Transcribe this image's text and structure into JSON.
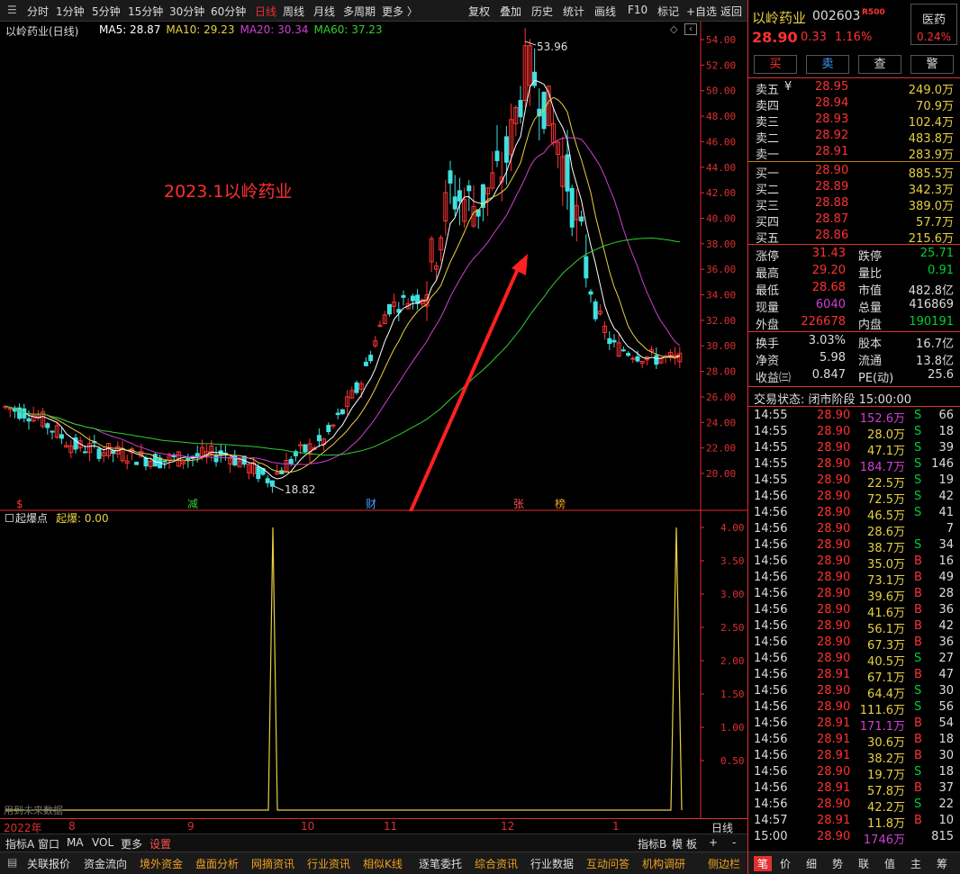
{
  "toolbar": {
    "left": [
      "分时",
      "1分钟",
      "5分钟",
      "15分钟",
      "30分钟",
      "60分钟",
      "日线",
      "周线",
      "月线",
      "多周期",
      "更多 〉"
    ],
    "active_index": 6,
    "right": [
      "复权",
      "叠加",
      "历史",
      "统计",
      "画线",
      "F10",
      "标记",
      "+自选",
      "返回"
    ]
  },
  "chart": {
    "title": "以岭药业(日线)",
    "ma": [
      {
        "label": "MA5: 28.87",
        "color": "#ffffff"
      },
      {
        "label": "MA10: 29.23",
        "color": "#e8d040"
      },
      {
        "label": "MA20: 30.34",
        "color": "#d040d0"
      },
      {
        "label": "MA60: 37.23",
        "color": "#30d030"
      }
    ],
    "annotation": "2023.1以岭药业",
    "high_label": "53.96",
    "low_label": "18.82",
    "price_ticks": [
      "54.00",
      "52.00",
      "50.00",
      "48.00",
      "46.00",
      "44.00",
      "42.00",
      "40.00",
      "38.00",
      "36.00",
      "34.00",
      "32.00",
      "30.00",
      "28.00",
      "26.00",
      "24.00",
      "22.00",
      "20.00"
    ],
    "events": [
      "$",
      "减",
      "财",
      "张",
      "榜"
    ],
    "indicator_title": "起爆点",
    "indicator_value": "起爆: 0.00",
    "ind_ticks": [
      "4.00",
      "3.50",
      "3.00",
      "2.50",
      "2.00",
      "1.50",
      "1.00",
      "0.50"
    ],
    "future_note": "用到未来数据",
    "x_labels": [
      "2022年",
      "8",
      "9",
      "10",
      "11",
      "12",
      "1"
    ],
    "period_label": "日线"
  },
  "chart_data": {
    "type": "candlestick",
    "title": "以岭药业(日线)",
    "ylim": [
      18,
      55
    ],
    "high": 53.96,
    "low": 18.82,
    "ma": {
      "MA5": 28.87,
      "MA10": 29.23,
      "MA20": 30.34,
      "MA60": 37.23
    },
    "indicator": {
      "name": "起爆点",
      "ylim": [
        0,
        4.2
      ],
      "spikes": [
        4.0,
        4.0
      ]
    }
  },
  "bottom_tools": {
    "left": [
      "指标A",
      "窗口",
      "MA",
      "VOL",
      "更多",
      "设置"
    ],
    "right": [
      "指标B",
      "模",
      "板",
      "+",
      "-"
    ]
  },
  "bottom_tabs": [
    "关联报价",
    "资金流向",
    "境外资金",
    "盘面分析",
    "网摘资讯",
    "行业资讯",
    "相似K线",
    "逐笔委托",
    "综合资讯",
    "行业数据",
    "互动问答",
    "机构调研",
    "侧边栏"
  ],
  "panel": {
    "name": "以岭药业",
    "code": "002603",
    "tag": "R500",
    "sector": "医药",
    "sector_pct": "0.24%",
    "price": "28.90",
    "change": "0.33",
    "change_pct": "1.16%",
    "actions": [
      "买",
      "卖",
      "查",
      "警"
    ],
    "asks": [
      {
        "label": "卖五",
        "price": "28.95",
        "vol": "249.0万"
      },
      {
        "label": "卖四",
        "price": "28.94",
        "vol": "70.9万"
      },
      {
        "label": "卖三",
        "price": "28.93",
        "vol": "102.4万"
      },
      {
        "label": "卖二",
        "price": "28.92",
        "vol": "483.8万"
      },
      {
        "label": "卖一",
        "price": "28.91",
        "vol": "283.9万"
      }
    ],
    "ask_unit": "¥",
    "bids": [
      {
        "label": "买一",
        "price": "28.90",
        "vol": "885.5万"
      },
      {
        "label": "买二",
        "price": "28.89",
        "vol": "342.3万"
      },
      {
        "label": "买三",
        "price": "28.88",
        "vol": "389.0万"
      },
      {
        "label": "买四",
        "price": "28.87",
        "vol": "57.7万"
      },
      {
        "label": "买五",
        "price": "28.86",
        "vol": "215.6万"
      }
    ],
    "stats": [
      {
        "l": "涨停",
        "lv": "31.43",
        "lc": "red",
        "r": "跌停",
        "rv": "25.71",
        "rc": "green"
      },
      {
        "l": "最高",
        "lv": "29.20",
        "lc": "red",
        "r": "量比",
        "rv": "0.91",
        "rc": "green"
      },
      {
        "l": "最低",
        "lv": "28.68",
        "lc": "red",
        "r": "市值",
        "rv": "482.8亿",
        "rc": "white"
      },
      {
        "l": "现量",
        "lv": "6040",
        "lc": "magenta",
        "r": "总量",
        "rv": "416869",
        "rc": "white"
      },
      {
        "l": "外盘",
        "lv": "226678",
        "lc": "red",
        "r": "内盘",
        "rv": "190191",
        "rc": "green"
      }
    ],
    "fund": [
      {
        "l": "换手",
        "lv": "3.03%",
        "r": "股本",
        "rv": "16.7亿"
      },
      {
        "l": "净资",
        "lv": "5.98",
        "r": "流通",
        "rv": "13.8亿"
      },
      {
        "l": "收益㈢",
        "lv": "0.847",
        "r": "PE(动)",
        "rv": "25.6"
      }
    ],
    "trade_status": "交易状态: 闭市阶段 15:00:00",
    "ticks": [
      {
        "t": "14:55",
        "p": "28.90",
        "v": "152.6万",
        "vc": "magenta",
        "d": "S",
        "n": "66"
      },
      {
        "t": "14:55",
        "p": "28.90",
        "v": "28.0万",
        "vc": "yellow",
        "d": "S",
        "n": "18"
      },
      {
        "t": "14:55",
        "p": "28.90",
        "v": "47.1万",
        "vc": "yellow",
        "d": "S",
        "n": "39"
      },
      {
        "t": "14:55",
        "p": "28.90",
        "v": "184.7万",
        "vc": "magenta",
        "d": "S",
        "n": "146"
      },
      {
        "t": "14:55",
        "p": "28.90",
        "v": "22.5万",
        "vc": "yellow",
        "d": "S",
        "n": "19"
      },
      {
        "t": "14:56",
        "p": "28.90",
        "v": "72.5万",
        "vc": "yellow",
        "d": "S",
        "n": "42"
      },
      {
        "t": "14:56",
        "p": "28.90",
        "v": "46.5万",
        "vc": "yellow",
        "d": "S",
        "n": "41"
      },
      {
        "t": "14:56",
        "p": "28.90",
        "v": "28.6万",
        "vc": "yellow",
        "d": "",
        "n": "7"
      },
      {
        "t": "14:56",
        "p": "28.90",
        "v": "38.7万",
        "vc": "yellow",
        "d": "S",
        "n": "34"
      },
      {
        "t": "14:56",
        "p": "28.90",
        "v": "35.0万",
        "vc": "yellow",
        "d": "B",
        "n": "16"
      },
      {
        "t": "14:56",
        "p": "28.90",
        "v": "73.1万",
        "vc": "yellow",
        "d": "B",
        "n": "49"
      },
      {
        "t": "14:56",
        "p": "28.90",
        "v": "39.6万",
        "vc": "yellow",
        "d": "B",
        "n": "28"
      },
      {
        "t": "14:56",
        "p": "28.90",
        "v": "41.6万",
        "vc": "yellow",
        "d": "B",
        "n": "36"
      },
      {
        "t": "14:56",
        "p": "28.90",
        "v": "56.1万",
        "vc": "yellow",
        "d": "B",
        "n": "42"
      },
      {
        "t": "14:56",
        "p": "28.90",
        "v": "67.3万",
        "vc": "yellow",
        "d": "B",
        "n": "36"
      },
      {
        "t": "14:56",
        "p": "28.90",
        "v": "40.5万",
        "vc": "yellow",
        "d": "S",
        "n": "27"
      },
      {
        "t": "14:56",
        "p": "28.91",
        "v": "67.1万",
        "vc": "yellow",
        "d": "B",
        "n": "47"
      },
      {
        "t": "14:56",
        "p": "28.90",
        "v": "64.4万",
        "vc": "yellow",
        "d": "S",
        "n": "30"
      },
      {
        "t": "14:56",
        "p": "28.90",
        "v": "111.6万",
        "vc": "yellow",
        "d": "S",
        "n": "56"
      },
      {
        "t": "14:56",
        "p": "28.91",
        "v": "171.1万",
        "vc": "magenta",
        "d": "B",
        "n": "54"
      },
      {
        "t": "14:56",
        "p": "28.91",
        "v": "30.6万",
        "vc": "yellow",
        "d": "B",
        "n": "18"
      },
      {
        "t": "14:56",
        "p": "28.91",
        "v": "38.2万",
        "vc": "yellow",
        "d": "B",
        "n": "30"
      },
      {
        "t": "14:56",
        "p": "28.90",
        "v": "19.7万",
        "vc": "yellow",
        "d": "S",
        "n": "18"
      },
      {
        "t": "14:56",
        "p": "28.91",
        "v": "57.8万",
        "vc": "yellow",
        "d": "B",
        "n": "37"
      },
      {
        "t": "14:56",
        "p": "28.90",
        "v": "42.2万",
        "vc": "yellow",
        "d": "S",
        "n": "22"
      },
      {
        "t": "14:57",
        "p": "28.91",
        "v": "11.8万",
        "vc": "yellow",
        "d": "B",
        "n": "10"
      },
      {
        "t": "15:00",
        "p": "28.90",
        "v": "1746万",
        "vc": "magenta",
        "d": "",
        "n": "815"
      }
    ],
    "panel_tabs": [
      "笔",
      "价",
      "细",
      "势",
      "联",
      "值",
      "主",
      "筹"
    ]
  }
}
